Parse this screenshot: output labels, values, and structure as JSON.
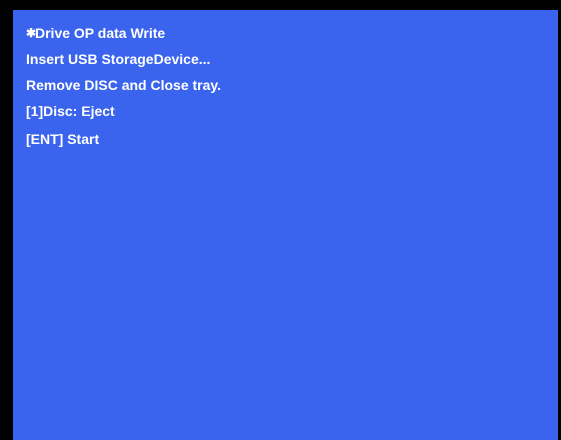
{
  "colors": {
    "background": "#3a64ee",
    "frame": "#000000",
    "text": "#ffffff"
  },
  "menu": {
    "title_bullet": "✱",
    "title": "Drive OP data Write",
    "line2": "Insert USB StorageDevice...",
    "line3": "Remove DISC and Close tray.",
    "line4": "[1]Disc: Eject",
    "line5": "[ENT] Start"
  }
}
